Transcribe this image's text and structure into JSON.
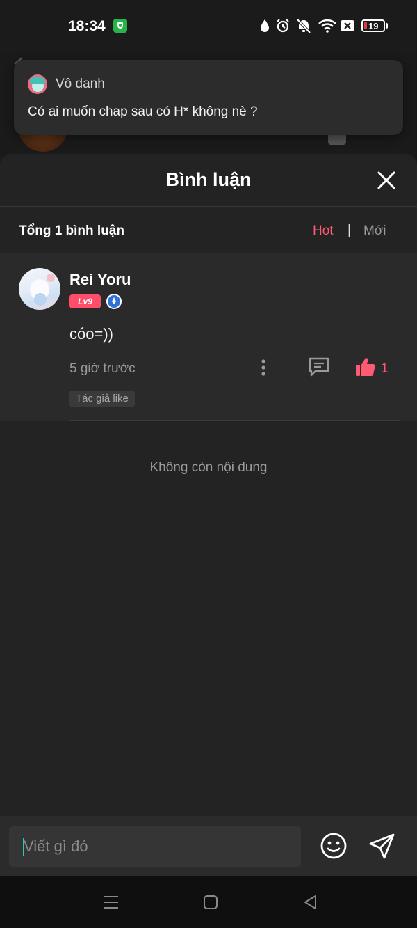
{
  "status_bar": {
    "time": "18:34",
    "battery_level": "19",
    "icons": [
      "app-shield-icon",
      "water-drop-icon",
      "alarm-icon",
      "bell-off-icon",
      "wifi-icon",
      "sim-x-icon",
      "battery-icon"
    ]
  },
  "notification": {
    "sender": "Vô danh",
    "message": "Có ai muốn chap sau có H* không nè ?"
  },
  "sheet": {
    "title": "Bình luận",
    "count_label": "Tổng 1 bình luận",
    "sort": {
      "hot": "Hot",
      "separator": "|",
      "new": "Mới",
      "active": "hot"
    }
  },
  "comments": [
    {
      "user": "Rei Yoru",
      "level": "Lv9",
      "text": "cóo=))",
      "time": "5 giờ trước",
      "likes": "1",
      "tag": "Tác giả like"
    }
  ],
  "end_text": "Không còn nội dung",
  "input": {
    "placeholder": "Viết gì đó"
  },
  "colors": {
    "accent": "#ff5a73",
    "sheet_bg": "#232323",
    "comment_bg": "#2a2a2a",
    "caret": "#2fc8b8"
  }
}
